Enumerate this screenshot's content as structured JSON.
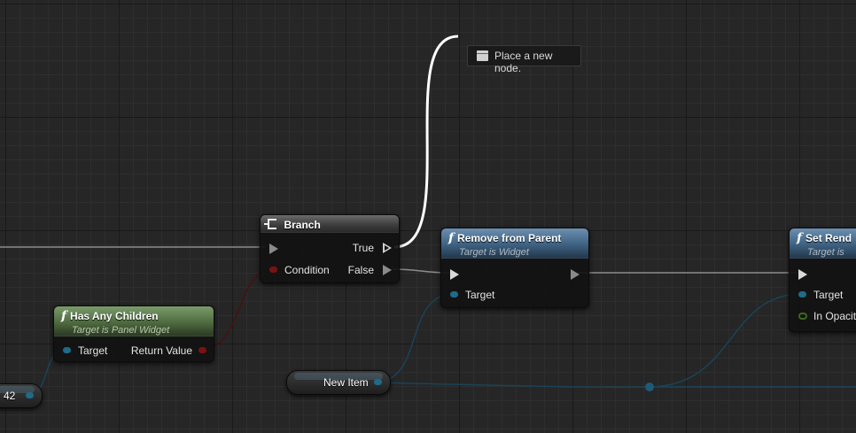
{
  "context_hint": {
    "label": "Place a new node.",
    "icon": "document-icon"
  },
  "branch": {
    "title": "Branch",
    "icon": "branch-icon",
    "pins": {
      "true": "True",
      "condition": "Condition",
      "false": "False"
    }
  },
  "has_any_children": {
    "title": "Has Any Children",
    "subtitle": "Target is Panel Widget",
    "icon": "function-icon",
    "pins": {
      "target": "Target",
      "return_value": "Return Value"
    }
  },
  "remove_from_parent": {
    "title": "Remove from Parent",
    "subtitle": "Target is Widget",
    "icon": "function-icon",
    "pins": {
      "target": "Target"
    }
  },
  "set_render": {
    "title": "Set Rend",
    "subtitle": "Target is",
    "icon": "function-icon",
    "pins": {
      "target": "Target",
      "in_opacity": "In Opacity"
    }
  },
  "variables": {
    "new_item": "New Item",
    "partial_value": "42"
  },
  "colors": {
    "exec": "#ffffff",
    "object_pin": "#1e6b8a",
    "bool_pin": "#7a1212",
    "float_pin": "#3a6a1c",
    "pure_function_header": "#5a7a4a",
    "function_header": "#4a6e90"
  }
}
